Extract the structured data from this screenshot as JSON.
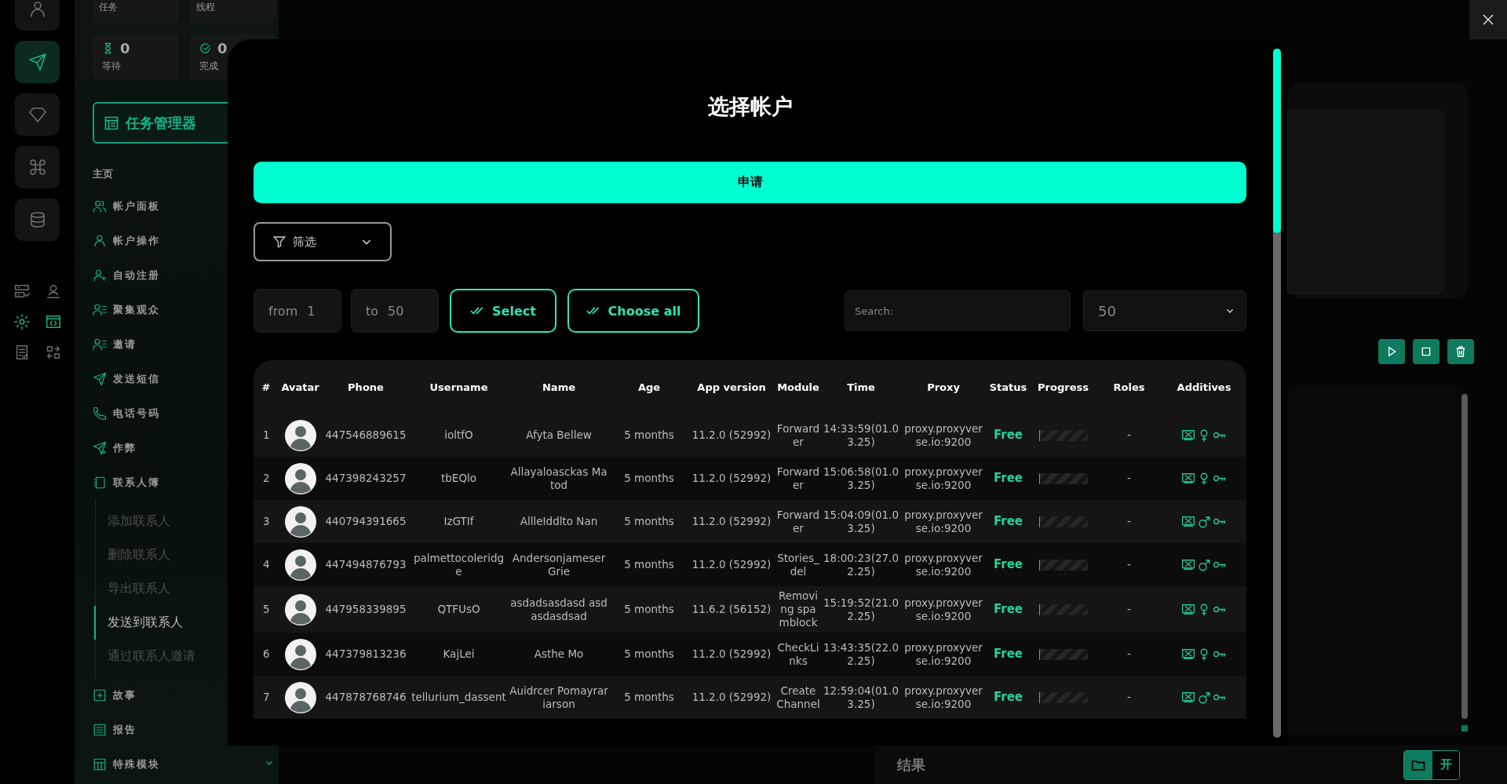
{
  "rail": [
    {
      "selected": false
    },
    {
      "selected": true
    },
    {
      "selected": false
    },
    {
      "selected": false
    },
    {
      "selected": false
    }
  ],
  "sidebar": {
    "top_cards": [
      {
        "label": "任务"
      },
      {
        "label": "线程"
      }
    ],
    "counters": [
      {
        "kind": "waiting",
        "value": "0",
        "label": "等待"
      },
      {
        "kind": "done",
        "value": "0",
        "label": "完成"
      }
    ],
    "task_manager_button": "任务管理器",
    "section": "主页",
    "items": [
      {
        "label": "帐户面板"
      },
      {
        "label": "帐户操作"
      },
      {
        "label": "自动注册"
      },
      {
        "label": "聚集观众"
      },
      {
        "label": "邀请"
      },
      {
        "label": "发送短信"
      },
      {
        "label": "电话号码"
      },
      {
        "label": "作弊"
      },
      {
        "label": "联系人簿",
        "expanded": true,
        "children": [
          {
            "label": "添加联系人",
            "selected": false
          },
          {
            "label": "删除联系人",
            "selected": false
          },
          {
            "label": "导出联系人",
            "selected": false
          },
          {
            "label": "发送到联系人",
            "selected": true
          },
          {
            "label": "通过联系人邀请",
            "selected": false
          }
        ]
      },
      {
        "label": "故事"
      },
      {
        "label": "报告"
      },
      {
        "label": "特殊模块",
        "expanded": false
      }
    ]
  },
  "modal": {
    "title": "选择帐户",
    "apply_button": "申请",
    "filter": "筛选",
    "range": {
      "from_label": "from",
      "from_value": "1",
      "to_label": "to",
      "to_value": "50"
    },
    "buttons": [
      "Select",
      "Choose all"
    ],
    "search": {
      "placeholder": "Search:"
    },
    "page_size": "50",
    "table": {
      "columns": [
        "#",
        "Avatar",
        "Phone",
        "Username",
        "Name",
        "Age",
        "App version",
        "Module",
        "Time",
        "Proxy",
        "Status",
        "Progress",
        "Roles",
        "Additives"
      ],
      "rows": [
        {
          "index": "1",
          "phone": "447546889615",
          "username": "ioltfO",
          "name": "Afyta Bellew",
          "age": "5 months",
          "app_version": "11.2.0 (52992)",
          "module": "Forwarder",
          "time": "14:33:59(01.03.25)",
          "proxy": "proxy.proxyverse.io:9200",
          "status": "Free",
          "roles": "-",
          "progress": {
            "level": 0
          },
          "kind": "female"
        },
        {
          "index": "2",
          "phone": "447398243257",
          "username": "tbEQlo",
          "name": "Allayaloasckas Matod",
          "age": "5 months",
          "app_version": "11.2.0 (52992)",
          "module": "Forwarder",
          "time": "15:06:58(01.03.25)",
          "proxy": "proxy.proxyverse.io:9200",
          "status": "Free",
          "roles": "-",
          "progress": {
            "level": 0
          },
          "kind": "female"
        },
        {
          "index": "3",
          "phone": "440794391665",
          "username": "IzGTIf",
          "name": "AllleIddlto Nan",
          "age": "5 months",
          "app_version": "11.2.0 (52992)",
          "module": "Forwarder",
          "time": "15:04:09(01.03.25)",
          "proxy": "proxy.proxyverse.io:9200",
          "status": "Free",
          "roles": "-",
          "progress": {
            "level": 0
          },
          "kind": "male"
        },
        {
          "index": "4",
          "phone": "447494876793",
          "username": "palmettocoleridge",
          "name": "Andersonjameser Grie",
          "age": "5 months",
          "app_version": "11.2.0 (52992)",
          "module": "Stories_del",
          "time": "18:00:23(27.02.25)",
          "proxy": "proxy.proxyverse.io:9200",
          "status": "Free",
          "roles": "-",
          "progress": {
            "level": 0
          },
          "kind": "male"
        },
        {
          "index": "5",
          "phone": "447958339895",
          "username": "QTFUsO",
          "name": "asdadsasdasd asdasdasdsad",
          "age": "5 months",
          "app_version": "11.6.2 (56152)",
          "module": "Removing spamblock",
          "time": "15:19:52(21.02.25)",
          "proxy": "proxy.proxyverse.io:9200",
          "status": "Free",
          "roles": "-",
          "progress": {
            "level": 0
          },
          "kind": "female"
        },
        {
          "index": "6",
          "phone": "447379813236",
          "username": "KajLei",
          "name": "Asthe Mo",
          "age": "5 months",
          "app_version": "11.2.0 (52992)",
          "module": "CheckLinks",
          "time": "13:43:35(22.02.25)",
          "proxy": "proxy.proxyverse.io:9200",
          "status": "Free",
          "roles": "-",
          "progress": {
            "level": 0
          },
          "kind": "female"
        },
        {
          "index": "7",
          "phone": "447878768746",
          "username": "tellurium_dassent",
          "name": "Auidrcer Pomayrariarson",
          "age": "5 months",
          "app_version": "11.2.0 (52992)",
          "module": "Create Channel",
          "time": "12:59:04(01.03.25)",
          "proxy": "proxy.proxyverse.io:9200",
          "status": "Free",
          "roles": "-",
          "progress": {
            "level": 0
          },
          "kind": "male"
        }
      ]
    }
  },
  "results_label": "结果",
  "open_button": "开"
}
